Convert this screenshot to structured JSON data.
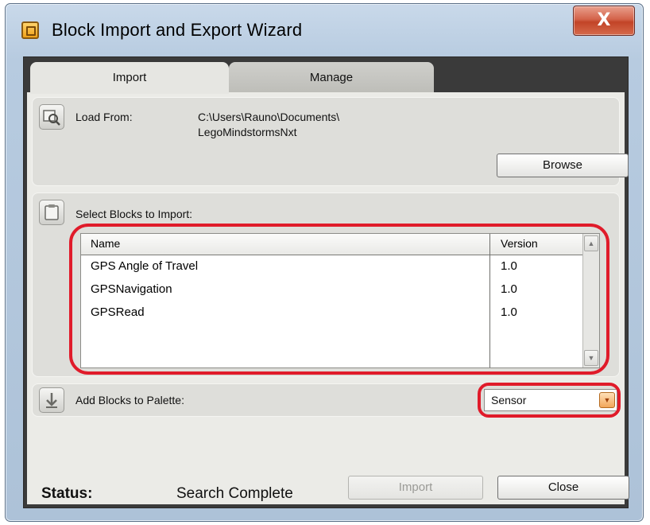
{
  "window": {
    "title": "Block Import and Export Wizard",
    "close_glyph": "X"
  },
  "tabs": [
    {
      "label": "Import",
      "active": true
    },
    {
      "label": "Manage",
      "active": false
    }
  ],
  "load_from": {
    "label": "Load From:",
    "path_line1": "C:\\Users\\Rauno\\Documents\\",
    "path_line2": "LegoMindstormsNxt",
    "browse_button": "Browse"
  },
  "select_blocks": {
    "label": "Select Blocks to Import:",
    "columns": [
      "Name",
      "Version"
    ],
    "rows": [
      {
        "name": "GPS Angle of Travel",
        "version": "1.0"
      },
      {
        "name": "GPSNavigation",
        "version": "1.0"
      },
      {
        "name": "GPSRead",
        "version": "1.0"
      }
    ]
  },
  "palette": {
    "label": "Add Blocks to Palette:",
    "selected": "Sensor"
  },
  "status": {
    "label": "Status:",
    "value": "Search Complete"
  },
  "buttons": {
    "import": "Import",
    "close": "Close"
  },
  "colors": {
    "highlight": "#e01b2a",
    "close_button": "#c24427"
  }
}
